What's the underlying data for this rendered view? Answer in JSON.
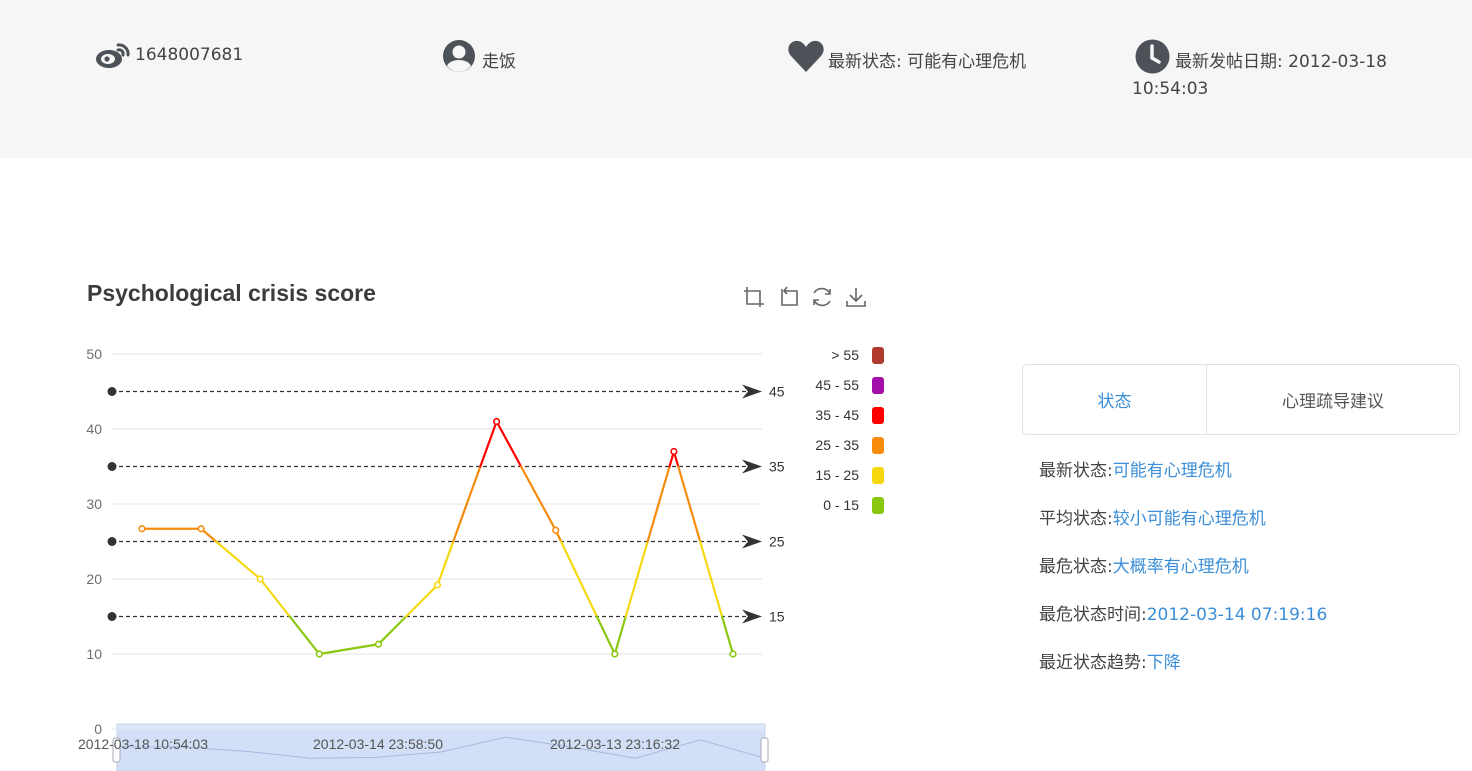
{
  "header": {
    "weibo_id": "1648007681",
    "username": "走饭",
    "latest_status_label": "最新状态:",
    "latest_status_value": "可能有心理危机",
    "latest_post_label": "最新发帖日期:",
    "latest_post_date": "2012-03-18",
    "latest_post_time": "10:54:03",
    "icons": [
      "weibo-icon",
      "user-icon",
      "heart-icon",
      "clock-icon"
    ]
  },
  "chart_data": {
    "type": "line",
    "title": "Psychological crisis score",
    "x": [
      "2012-03-18 10:54:03",
      "",
      "",
      "",
      "2012-03-14 23:58:50",
      "",
      "",
      "",
      "2012-03-13 23:16:32",
      "",
      "",
      ""
    ],
    "series": [
      {
        "values": [
          26.7,
          26.7,
          20,
          10,
          11.3,
          19.2,
          41,
          26.5,
          10,
          37,
          10
        ]
      }
    ],
    "point_dates": [
      "2012-03-18 10:54:03",
      "",
      "",
      "",
      "",
      "2012-03-14 23:58:50",
      "",
      "",
      "",
      "2012-03-13 23:16:32",
      ""
    ],
    "yticks": [
      0,
      10,
      20,
      30,
      40,
      50
    ],
    "ylim": [
      0,
      50
    ],
    "grid": true,
    "mark_lines": [
      45,
      35,
      25,
      15
    ],
    "visual_map": [
      {
        "label": "> 55",
        "color": "#b03a2e"
      },
      {
        "label": "45 - 55",
        "color": "#a10ea8"
      },
      {
        "label": "35 - 45",
        "color": "#ff0000"
      },
      {
        "label": "25 - 35",
        "color": "#f78b0c"
      },
      {
        "label": "15 - 25",
        "color": "#f5d80f"
      },
      {
        "label": "0 - 15",
        "color": "#8ac80f"
      }
    ],
    "legend_position": "right",
    "zoom_labels": [
      "2012-03-18 10:54:03",
      "2012-03-14 23:58:50",
      "2012-03-13 23:16:32"
    ]
  },
  "tabs": [
    {
      "label": "状态",
      "active": true
    },
    {
      "label": "心理疏导建议",
      "active": false
    }
  ],
  "status": {
    "latest": {
      "label": "最新状态:",
      "value": "可能有心理危机"
    },
    "average": {
      "label": "平均状态:",
      "value": "较小可能有心理危机"
    },
    "worst": {
      "label": "最危状态:",
      "value": "大概率有心理危机"
    },
    "worst_time": {
      "label": "最危状态时间:",
      "value": "2012-03-14 07:19:16"
    },
    "trend": {
      "label": "最近状态趋势:",
      "value": "下降"
    }
  },
  "colors": {
    "accent": "#3b8ed8",
    "topbar": "#f6f6f6"
  }
}
